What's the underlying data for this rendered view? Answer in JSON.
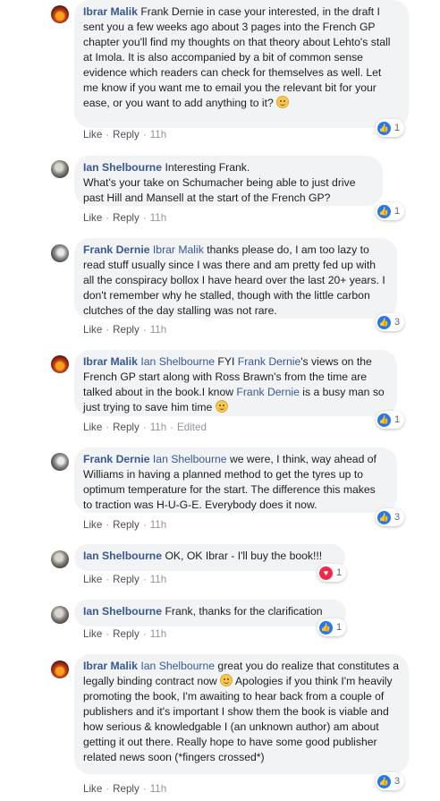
{
  "common": {
    "like": "Like",
    "reply": "Reply",
    "sep": "·"
  },
  "comments": [
    {
      "author": "Ibrar Malik",
      "text": "Frank Dernie in case your interested, in the draft I sent you a few weeks ago about 3 pages into the French GP chapter you'll find my thoughts on that theory about Lehto's stall at Imola. It is also accompanied by a bit of common sense evidence which readers can check for themselves as well. Let me know if you want me to email you the relevant bit for your ease, or you want to add anything to it?",
      "time": "11h",
      "reaction": {
        "type": "like-icon",
        "count": "1"
      }
    },
    {
      "author": "Ian Shelbourne",
      "line1": "Interesting Frank.",
      "line2": "What's your take on Schumacher being able to just drive past Hill and Mansell at the start of the French GP?",
      "time": "11h",
      "reaction": {
        "type": "like-icon",
        "count": "1"
      }
    },
    {
      "author": "Frank Dernie",
      "mention": "Ibrar Malik",
      "text": "thanks please do, I am too lazy to read stuff usually since I was there and am pretty fed up with all the conspiracy bollox I have heard over the last 20+ years. I don't remember why he stalled, though with the little carbon clutches of the day stalling was not rare.",
      "time": "11h",
      "reaction": {
        "type": "like-icon",
        "count": "3"
      }
    },
    {
      "author": "Ibrar Malik",
      "mention": "Ian Shelbourne",
      "part1": "FYI",
      "mention2": "Frank Dernie",
      "part2": "'s views on the French GP start along with Ross Brawn's from the time are talked about in the book.I know",
      "mention3": "Frank Dernie",
      "part3": "is a busy man so just trying to save him time",
      "time": "11h",
      "edited": "Edited",
      "reaction": {
        "type": "like-icon",
        "count": "1"
      }
    },
    {
      "author": "Frank Dernie",
      "mention": "Ian Shelbourne",
      "text": "we were, I think, way ahead of Williams in having a planned method to get the tyres up to optimum temperature for the start. The difference this makes to traction was H-U-G-E. Everybody does it now.",
      "time": "11h",
      "reaction": {
        "type": "like-icon",
        "count": "3"
      }
    },
    {
      "author": "Ian Shelbourne",
      "text": "OK, OK Ibrar - I'll buy the book!!!",
      "time": "11h",
      "reaction": {
        "type": "love-icon",
        "count": "1"
      }
    },
    {
      "author": "Ian Shelbourne",
      "text": "Frank, thanks for the clarification",
      "time": "11h",
      "reaction": {
        "type": "like-icon",
        "count": "1"
      }
    },
    {
      "author": "Ibrar Malik",
      "mention": "Ian Shelbourne",
      "part1": "great you do realize that constitutes a legally binding contract now",
      "part2": "Apologies if you think I'm heavily promoting the book, I'm awaiting to hear back from a couple of publishers and it's important I show them the book is viable and how serious & knowledgable I (an unknown author) am about getting it out there. Really hope to have some good publisher related news soon (*fingers crossed*)",
      "time": "11h",
      "reaction": {
        "type": "like-icon",
        "count": "3"
      }
    }
  ]
}
